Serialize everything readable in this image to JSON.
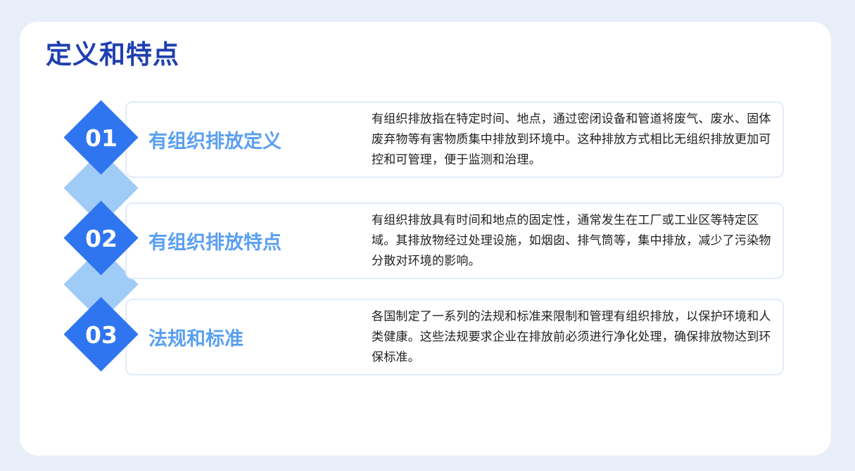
{
  "page": {
    "title": "定义和特点"
  },
  "colors": {
    "background": "#e8eef7",
    "title": "#1f3fb0",
    "accent_dark": "#2f75f0",
    "accent_light": "#9fcbf7",
    "heading": "#5a9ff2"
  },
  "items": [
    {
      "number": "01",
      "heading": "有组织排放定义",
      "description": "有组织排放指在特定时间、地点，通过密闭设备和管道将废气、废水、固体废弃物等有害物质集中排放到环境中。这种排放方式相比无组织排放更加可控和可管理，便于监测和治理。"
    },
    {
      "number": "02",
      "heading": "有组织排放特点",
      "description": "有组织排放具有时间和地点的固定性，通常发生在工厂或工业区等特定区域。其排放物经过处理设施，如烟囱、排气筒等，集中排放，减少了污染物分散对环境的影响。"
    },
    {
      "number": "03",
      "heading": "法规和标准",
      "description": "各国制定了一系列的法规和标准来限制和管理有组织排放，以保护环境和人类健康。这些法规要求企业在排放前必须进行净化处理，确保排放物达到环保标准。"
    }
  ]
}
